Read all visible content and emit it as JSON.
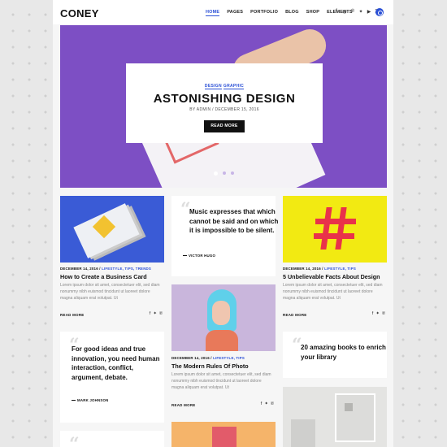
{
  "brand": {
    "logo": "CONEY"
  },
  "nav": {
    "items": [
      "HOME",
      "PAGES",
      "PORTFOLIO",
      "BLOG",
      "SHOP",
      "ELEMENTS"
    ],
    "active_index": 0,
    "social_icons": [
      "facebook-icon",
      "instagram-icon",
      "pinterest-icon",
      "twitter-icon",
      "youtube-icon",
      "rss-icon"
    ],
    "social_glyphs": [
      "f",
      "◎",
      "℗",
      "✦",
      "▶",
      "☰"
    ],
    "search_icon": "search-icon"
  },
  "hero": {
    "categories": [
      "DESIGN",
      "GRAPHIC"
    ],
    "title": "ASTONISHING DESIGN",
    "meta": "BY ADMIN / DECEMBER 15, 2016",
    "button": "READ MORE",
    "slides": 3,
    "active_slide": 0,
    "accent_color": "#7d4fc4"
  },
  "posts": {
    "business_card": {
      "date": "DECEMBER 14, 2016 /",
      "categories": "LIFESTYLE, TIPS, TRENDS",
      "title": "How to Create a Business Card",
      "excerpt": "Lorem ipsum dolor sit amet, consectetuer elit, sed diam nonummy nibh euismod tincidunt ut laoreet dolore magna aliquam erat volutpat. Ut",
      "read_more": "READ MORE"
    },
    "facts": {
      "date": "DECEMBER 14, 2016 /",
      "categories": "LIFESTYLE, TIPS",
      "title": "5 Unbelievable Facts About Design",
      "excerpt": "Lorem ipsum dolor sit amet, consectetuer elit, sed diam nonummy nibh euismod tincidunt ut laoreet dolore magna aliquam erat volutpat. Ut",
      "read_more": "READ MORE"
    },
    "photo": {
      "date": "DECEMBER 14, 2016 /",
      "categories": "LIFESTYLE, TIPS",
      "title": "The Modern Rules Of Photo",
      "excerpt": "Lorem ipsum dolor sit amet, consectetuer elit, sed diam nonummy nibh euismod tincidunt ut laoreet dolore magna aliquam erat volutpat. Ut",
      "read_more": "READ MORE"
    },
    "books": {
      "title": "20 amazing books to enrich your library"
    }
  },
  "quotes": {
    "music": {
      "text": "Music expresses that which cannot be said and on which it is impossible to be silent.",
      "author": "VICTOR HUGO"
    },
    "ideas": {
      "text": "For good ideas and true innovation, you need human interaction, conflict, argument, debate.",
      "author": "MARK JOHNSON"
    }
  },
  "share_icons": [
    "f",
    "✦",
    "℗"
  ]
}
